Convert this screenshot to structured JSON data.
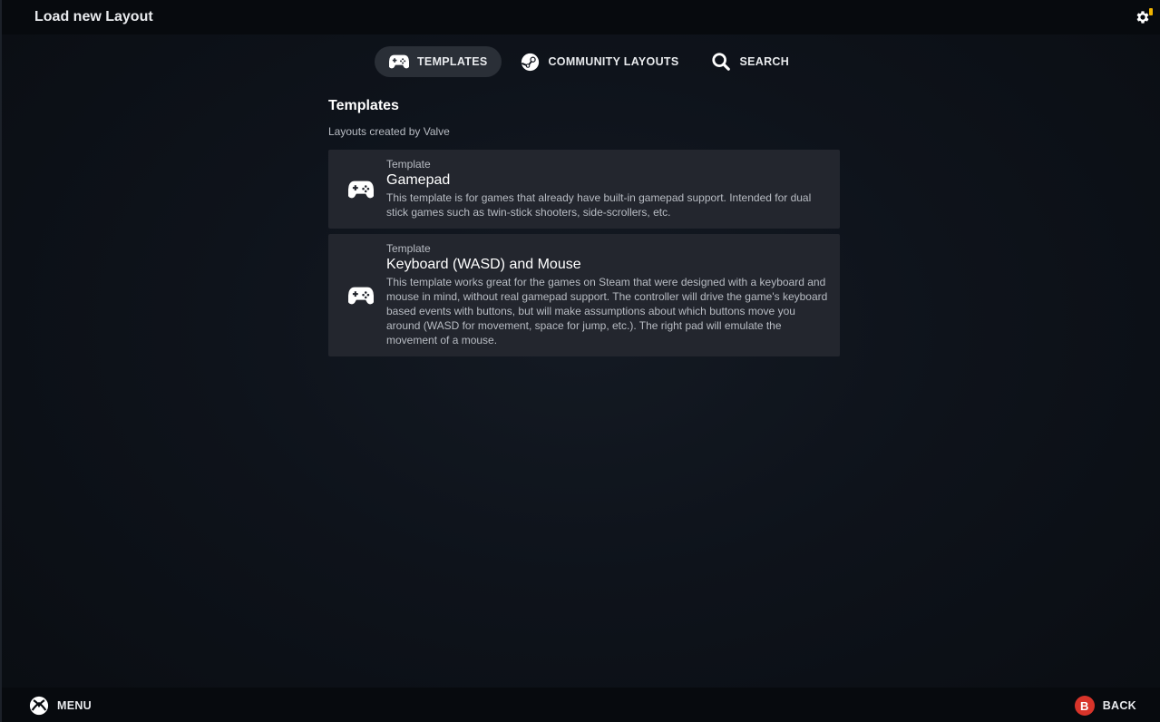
{
  "window": {
    "title": "Load new Layout"
  },
  "tabs": [
    {
      "label": "TEMPLATES",
      "icon": "gamepad-icon",
      "active": true
    },
    {
      "label": "COMMUNITY LAYOUTS",
      "icon": "steam-icon",
      "active": false
    },
    {
      "label": "SEARCH",
      "icon": "search-icon",
      "active": false
    }
  ],
  "section": {
    "title": "Templates",
    "subtitle": "Layouts created by Valve"
  },
  "templates": [
    {
      "kind": "Template",
      "name": "Gamepad",
      "description": "This template is for games that already have built-in gamepad support. Intended for dual stick games such as twin-stick shooters, side-scrollers, etc.",
      "icon": "gamepad-icon"
    },
    {
      "kind": "Template",
      "name": "Keyboard (WASD) and Mouse",
      "description": "This template works great for the games on Steam that were designed with a keyboard and mouse in mind, without real gamepad support. The controller will drive the game's keyboard based events with buttons, but will make assumptions about which buttons move you around (WASD for movement, space for jump, etc.). The right pad will emulate the movement of a mouse.",
      "icon": "gamepad-icon"
    }
  ],
  "footer": {
    "menu_label": "MENU",
    "back_label": "BACK",
    "back_glyph": "B"
  },
  "colors": {
    "accent_notification": "#f0b400",
    "back_button": "#d8342a",
    "card_bg": "#23262e",
    "active_tab_bg": "#2a2f37"
  }
}
